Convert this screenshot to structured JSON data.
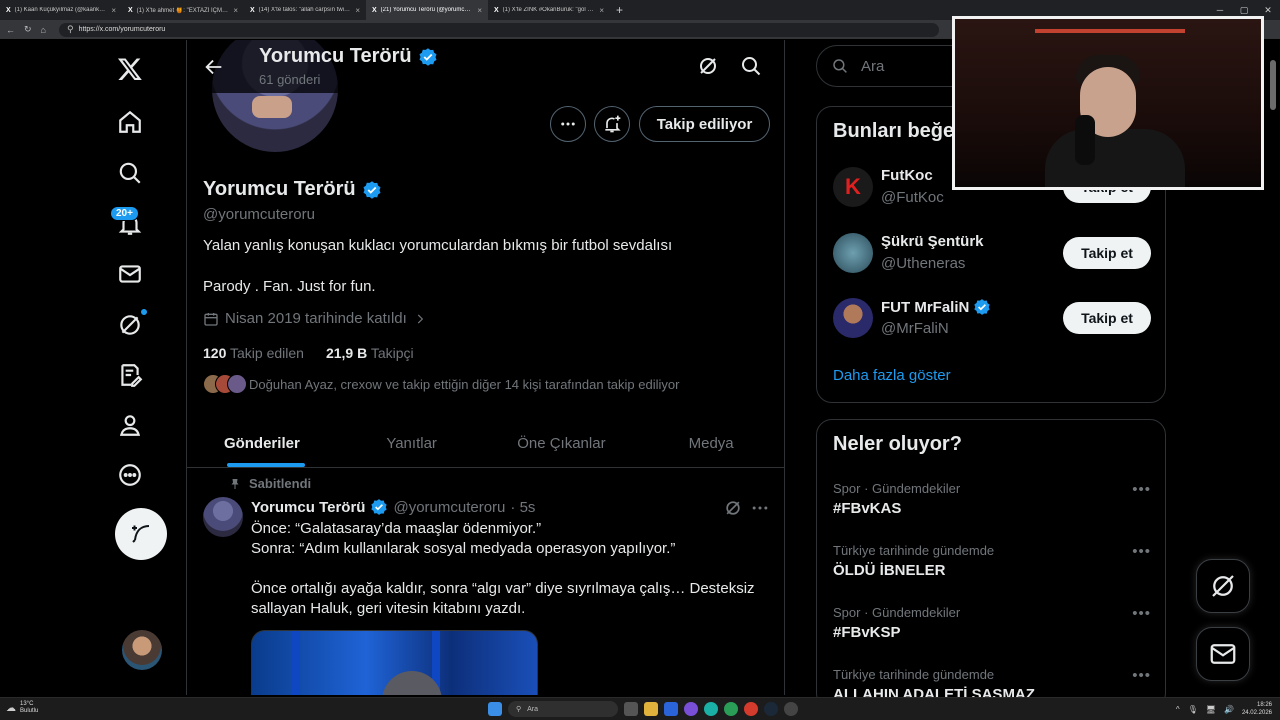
{
  "browser": {
    "tabs": [
      {
        "label": "(1) Kaan Küçükyılmaz (@kaankcky...",
        "active": false
      },
      {
        "label": "(1) X'te ahmet 🍯: \"EXTAZİ İÇMİY...",
        "active": false
      },
      {
        "label": "(14) X'te talos: \"allah carpsın twitter...",
        "active": false
      },
      {
        "label": "(21) Yorumcu Terörü (@yorumcut...",
        "active": true
      },
      {
        "label": "(1) X'te ZINK #OkanBuruk: \"gol ya...",
        "active": false
      }
    ],
    "url": "https://x.com/yorumcuteroru"
  },
  "nav": {
    "notifications_badge": "20+"
  },
  "profile": {
    "top_name": "Yorumcu Terörü",
    "post_count": "61 gönderi",
    "follow_button": "Takip ediliyor",
    "name": "Yorumcu Terörü",
    "handle": "@yorumcuteroru",
    "bio_line1": "Yalan yanlış konuşan kuklacı yorumculardan bıkmış bir futbol sevdalısı",
    "bio_line2": "Parody . Fan. Just for fun.",
    "joined": "Nisan 2019 tarihinde katıldı",
    "following_count": "120",
    "following_label": "Takip edilen",
    "followers_count": "21,9 B",
    "followers_label": "Takipçi",
    "followed_by": "Doğuhan Ayaz, crexow ve takip ettiğin diğer 14 kişi tarafından takip ediliyor"
  },
  "tabs": [
    "Gönderiler",
    "Yanıtlar",
    "Öne Çıkanlar",
    "Medya"
  ],
  "tweet": {
    "pinned_label": "Sabitlendi",
    "name": "Yorumcu Terörü",
    "handle": "@yorumcuteroru",
    "time": "· 5s",
    "line1": "Önce: “Galatasaray’da maaşlar ödenmiyor.”",
    "line2": "Sonra: “Adım kullanılarak sosyal medyada operasyon yapılıyor.”",
    "line3": "Önce ortalığı ayağa kaldır, sonra “algı var” diye sıyrılmaya çalış… Desteksiz sallayan Haluk, geri vitesin kitabını yazdı."
  },
  "sidebar": {
    "search_placeholder": "Ara",
    "who_to_follow_title": "Bunları beğenebilirsin",
    "suggestions": [
      {
        "name": "FutKoc",
        "handle": "@FutKoc",
        "button": "Takip et",
        "verified": false
      },
      {
        "name": "Şükrü Şentürk",
        "handle": "@Utheneras",
        "button": "Takip et",
        "verified": false
      },
      {
        "name": "FUT MrFaliN",
        "handle": "@MrFaliN",
        "button": "Takip et",
        "verified": true
      }
    ],
    "show_more": "Daha fazla göster",
    "trends_title": "Neler oluyor?",
    "trends": [
      {
        "category": "Spor · Gündemdekiler",
        "title": "#FBvKAS"
      },
      {
        "category": "Türkiye tarihinde gündemde",
        "title": "ÖLDÜ İBNELER"
      },
      {
        "category": "Spor · Gündemdekiler",
        "title": "#FBvKSP"
      },
      {
        "category": "Türkiye tarihinde gündemde",
        "title": "ALLAHIN ADALETİ ŞAŞMAZ"
      }
    ]
  },
  "taskbar": {
    "temp": "13°C",
    "weather": "Bulutlu",
    "search": "Ara",
    "time": "18:26",
    "date": "24.02.2026"
  },
  "colors": {
    "accent": "#1d9bf0",
    "background": "#000000",
    "border": "#2f3336",
    "muted": "#71767b"
  }
}
